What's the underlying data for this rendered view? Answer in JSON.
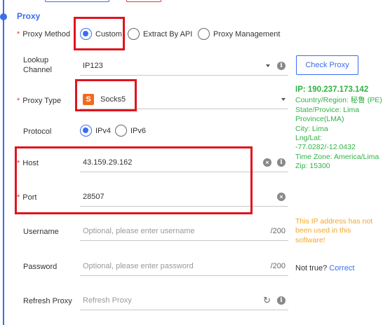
{
  "section": {
    "title": "Proxy"
  },
  "proxy_method": {
    "label": "Proxy Method",
    "options": [
      "Custom",
      "Extract By API",
      "Proxy Management"
    ],
    "selected": "Custom"
  },
  "lookup_channel": {
    "label": "Lookup Channel",
    "value": "IP123"
  },
  "check_button": {
    "label": "Check Proxy"
  },
  "proxy_type": {
    "label": "Proxy Type",
    "value": "Socks5",
    "icon_letter": "S"
  },
  "protocol": {
    "label": "Protocol",
    "options": [
      "IPv4",
      "IPv6"
    ],
    "selected": "IPv4"
  },
  "host": {
    "label": "Host",
    "value": "43.159.29.162"
  },
  "port": {
    "label": "Port",
    "value": "28507"
  },
  "username": {
    "label": "Username",
    "placeholder": "Optional, please enter username",
    "counter": "/200"
  },
  "password": {
    "label": "Password",
    "placeholder": "Optional, please enter password",
    "counter": "/200"
  },
  "refresh_proxy": {
    "label": "Refresh Proxy",
    "placeholder": "Refresh Proxy"
  },
  "ip_info": {
    "ip": "IP:  190.237.173.142",
    "lines": [
      "Country/Region: 秘鲁 (PE)",
      "State/Provice: Lima Province(LMA)",
      "City: Lima",
      "Lng/Lat: -77.0282/-12.0432",
      "Time Zone: America/Lima",
      "Zip: 15300"
    ],
    "warning": "This IP address has not been used in this software!",
    "not_true_text": "Not true?",
    "correct_link": "Correct"
  },
  "colors": {
    "accent": "#3a6df0",
    "highlight": "#e0141e",
    "success": "#2fb344",
    "warning": "#f5a623",
    "socks_badge": "#f26b1d"
  }
}
